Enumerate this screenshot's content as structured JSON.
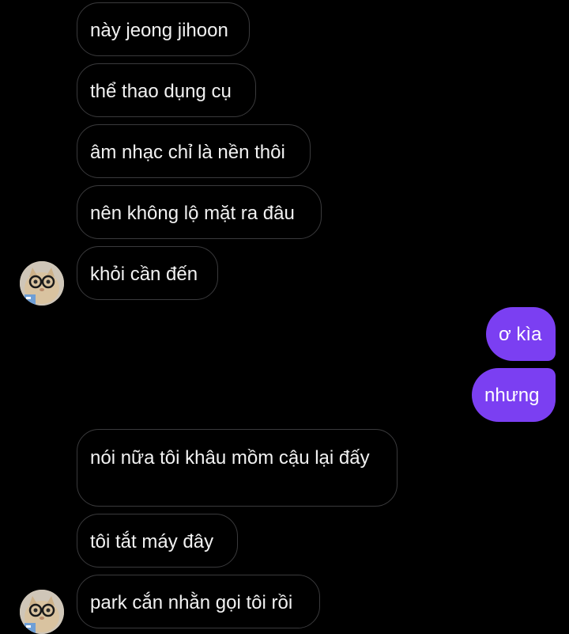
{
  "colors": {
    "background": "#000000",
    "incoming_bubble_border": "#3a3a3c",
    "outgoing_bubble": "#7b3ff2",
    "text": "#f2f2f2"
  },
  "messages": [
    {
      "sender": "them",
      "text": "này jeong jihoon"
    },
    {
      "sender": "them",
      "text": "thể thao dụng cụ"
    },
    {
      "sender": "them",
      "text": "âm nhạc chỉ là nền thôi"
    },
    {
      "sender": "them",
      "text": "nên không lộ mặt ra đâu"
    },
    {
      "sender": "them",
      "text": "khỏi cần đến"
    },
    {
      "sender": "me",
      "text": "ơ kìa"
    },
    {
      "sender": "me",
      "text": "nhưng"
    },
    {
      "sender": "them",
      "text": "nói nữa tôi khâu mồm cậu lại đấy"
    },
    {
      "sender": "them",
      "text": "tôi tắt máy đây"
    },
    {
      "sender": "them",
      "text": "park cắn nhằn gọi tôi rồi"
    }
  ],
  "avatars": [
    {
      "icon": "cat-with-glasses-avatar"
    },
    {
      "icon": "cat-with-glasses-avatar"
    }
  ]
}
